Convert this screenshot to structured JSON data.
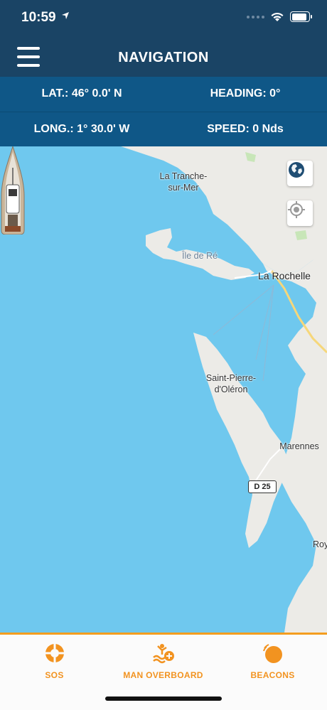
{
  "status_bar": {
    "time": "10:59"
  },
  "header": {
    "title": "NAVIGATION"
  },
  "info": {
    "lat": "LAT.: 46° 0.0' N",
    "heading": "HEADING: 0°",
    "long": "LONG.: 1° 30.0' W",
    "speed": "SPEED: 0 Nds"
  },
  "map": {
    "labels": {
      "la_tranche_1": "La Tranche-",
      "la_tranche_2": "sur-Mer",
      "ile_de_re": "Île de Ré",
      "la_rochelle": "La Rochelle",
      "saint_pierre_1": "Saint-Pierre-",
      "saint_pierre_2": "d'Oléron",
      "marennes": "Marennes",
      "royan_partial": "Roy",
      "road": "D 25"
    },
    "icons": [
      "globe-icon",
      "locate-icon",
      "boat-icon"
    ]
  },
  "tabs": [
    {
      "label": "SOS",
      "icon": "lifebuoy-icon"
    },
    {
      "label": "MAN OVERBOARD",
      "icon": "man-overboard-icon"
    },
    {
      "label": "BEACONS",
      "icon": "beacon-icon"
    }
  ],
  "colors": {
    "header": "#1a4465",
    "info_panel": "#0f5787",
    "sea": "#6fc8ee",
    "accent": "#f29320"
  }
}
